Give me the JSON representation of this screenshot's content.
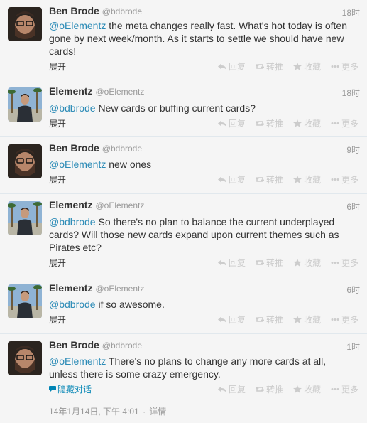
{
  "actions": {
    "reply": "回复",
    "retweet": "转推",
    "favorite": "收藏",
    "more": "更多"
  },
  "expand_label": "展开",
  "hide_conversation_label": "隐藏对话",
  "tweets": [
    {
      "name": "Ben Brode",
      "handle": "@bdbrode",
      "time": "18时",
      "mention": "@oElementz",
      "text": " the meta changes really fast. What's hot today is often gone by next week/month. As it starts to settle we should have new cards!"
    },
    {
      "name": "Elementz",
      "handle": "@oElementz",
      "time": "18时",
      "mention": "@bdbrode",
      "text": " New cards or buffing current cards?"
    },
    {
      "name": "Ben Brode",
      "handle": "@bdbrode",
      "time": "9时",
      "mention": "@oElementz",
      "text": " new ones"
    },
    {
      "name": "Elementz",
      "handle": "@oElementz",
      "time": "6时",
      "mention": "@bdbrode",
      "text": " So there's no plan to balance the current underplayed cards? Will those new cards expand upon current themes such as Pirates etc?"
    },
    {
      "name": "Elementz",
      "handle": "@oElementz",
      "time": "6时",
      "mention": "@bdbrode",
      "text": " if so awesome."
    },
    {
      "name": "Ben Brode",
      "handle": "@bdbrode",
      "time": "1时",
      "mention": "@oElementz",
      "text": " There's no plans to change any more cards at all, unless there is some crazy emergency."
    }
  ],
  "footer": {
    "date": "14年1月14日, 下午 4:01",
    "details": "详情"
  }
}
